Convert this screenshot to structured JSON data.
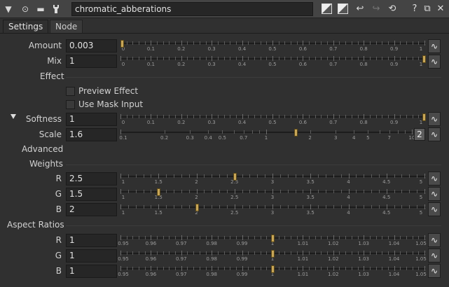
{
  "toolbar": {
    "node_name": "chromatic_abberations",
    "collapse_icon": "▼",
    "help_label": "?"
  },
  "tabs": [
    {
      "label": "Settings"
    },
    {
      "label": "Node"
    }
  ],
  "params": {
    "amount": {
      "label": "Amount",
      "value": "0.003",
      "handle_fraction": 0.0
    },
    "mix": {
      "label": "Mix",
      "value": "1",
      "handle_fraction": 1.0
    },
    "effect_label": "Effect",
    "preview_effect": {
      "label": "Preview Effect",
      "checked": false
    },
    "use_mask_input": {
      "label": "Use Mask Input",
      "checked": false
    },
    "softness": {
      "label": "Softness",
      "value": "1",
      "handle_fraction": 1.0
    },
    "scale": {
      "label": "Scale",
      "value": "1.6",
      "dim_button": "2"
    },
    "advanced_label": "Advanced",
    "weights_label": "Weights",
    "weights": [
      {
        "label": "R",
        "value": "2.5"
      },
      {
        "label": "G",
        "value": "1.5"
      },
      {
        "label": "B",
        "value": "2"
      }
    ],
    "aspect_label": "Aspect Ratios",
    "aspect": [
      {
        "label": "R",
        "value": "1"
      },
      {
        "label": "G",
        "value": "1"
      },
      {
        "label": "B",
        "value": "1"
      }
    ]
  },
  "scales": {
    "unit": {
      "min": 0,
      "max": 1,
      "labels": [
        "0",
        "0.1",
        "0.2",
        "0.3",
        "0.4",
        "0.5",
        "0.6",
        "0.7",
        "0.8",
        "0.9",
        "1"
      ]
    },
    "scale_log": {
      "labels": [
        "0.1",
        "0.2",
        "0.3",
        "0.4",
        "0.5",
        "0.7",
        "1",
        "2",
        "3",
        "4",
        "5",
        "7",
        "10"
      ]
    },
    "weights": {
      "min": 1,
      "max": 5,
      "labels": [
        "1",
        "1.5",
        "2",
        "2.5",
        "3",
        "3.5",
        "4",
        "4.5",
        "5"
      ]
    },
    "aspect": {
      "min": 0.95,
      "max": 1.05,
      "labels": [
        "0.95",
        "0.96",
        "0.97",
        "0.98",
        "0.99",
        "1",
        "1.01",
        "1.02",
        "1.03",
        "1.04",
        "1.05"
      ]
    }
  },
  "colors": {
    "handle": "#c8a658",
    "background": "#303030"
  }
}
